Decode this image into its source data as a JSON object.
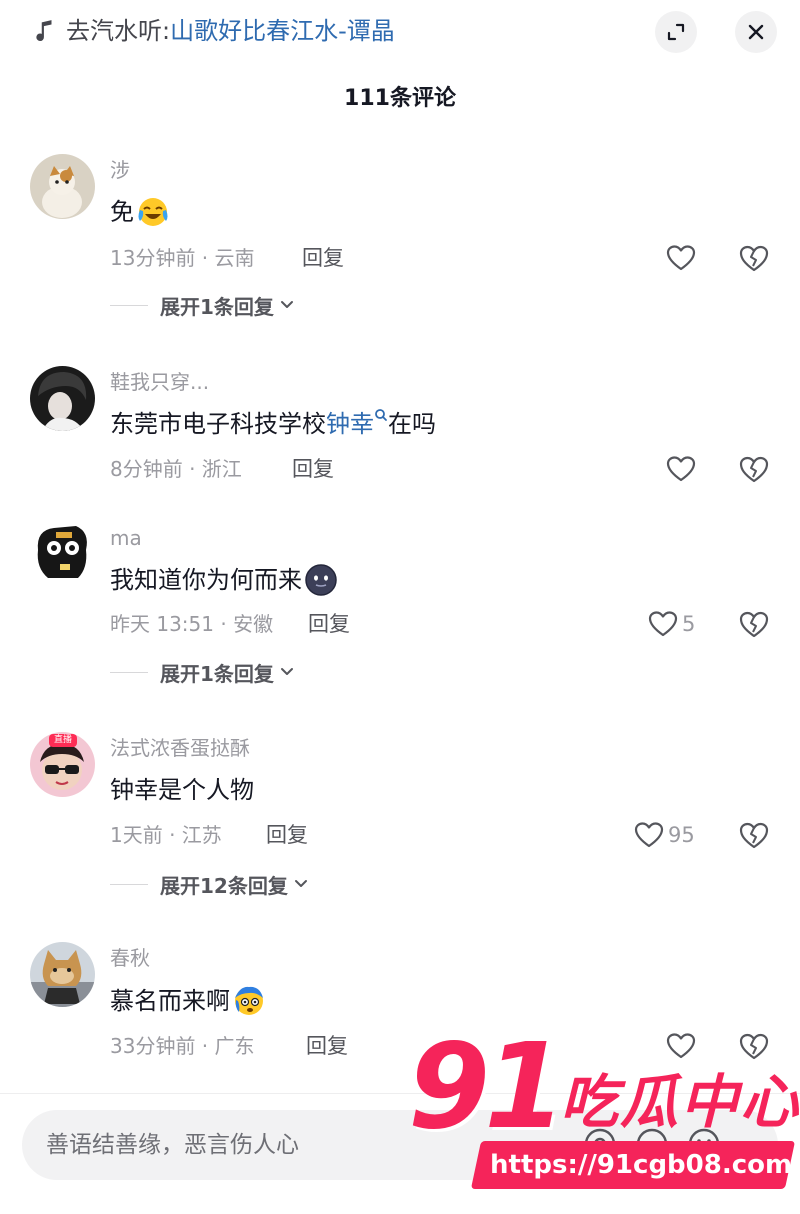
{
  "header": {
    "song_prefix": "去汽水听:",
    "song_title": "山歌好比春江水-谭晶",
    "comment_count": "111条评论"
  },
  "comments": [
    {
      "username": "涉",
      "content": "免",
      "meta": "13分钟前 · 云南",
      "reply_label": "回复",
      "like_count": "",
      "expand_label": "展开1条回复"
    },
    {
      "username": "鞋我只穿...",
      "content_before": "东莞市电子科技学校",
      "mention": "钟幸",
      "content_after": "在吗",
      "meta": "8分钟前 · 浙江",
      "reply_label": "回复",
      "like_count": ""
    },
    {
      "username": "ma",
      "content": "我知道你为何而来",
      "meta": "昨天 13:51 · 安徽",
      "reply_label": "回复",
      "like_count": "5",
      "expand_label": "展开1条回复"
    },
    {
      "username": "法式浓香蛋挞酥",
      "content": "钟幸是个人物",
      "meta": "1天前 · 江苏",
      "reply_label": "回复",
      "like_count": "95",
      "expand_label": "展开12条回复",
      "avatar_badge": "直播"
    },
    {
      "username": "春秋",
      "content": "慕名而来啊",
      "meta": "33分钟前 · 广东",
      "reply_label": "回复",
      "like_count": ""
    }
  ],
  "input": {
    "placeholder": "善语结善缘，恶言伤人心"
  },
  "watermark": {
    "big": "91",
    "brand": "吃瓜中心",
    "url": "https://91cgb08.com"
  },
  "colors": {
    "link": "#2f6bb0",
    "muted": "#9a9aa0",
    "watermark": "#f5245a"
  },
  "icons": [
    "music-note-icon",
    "collapse-icon",
    "close-icon",
    "heart-icon",
    "broken-heart-icon",
    "chevron-down-icon",
    "laugh-cry-emoji",
    "blob-emoji",
    "dizzy-emoji",
    "search-mini-icon"
  ]
}
